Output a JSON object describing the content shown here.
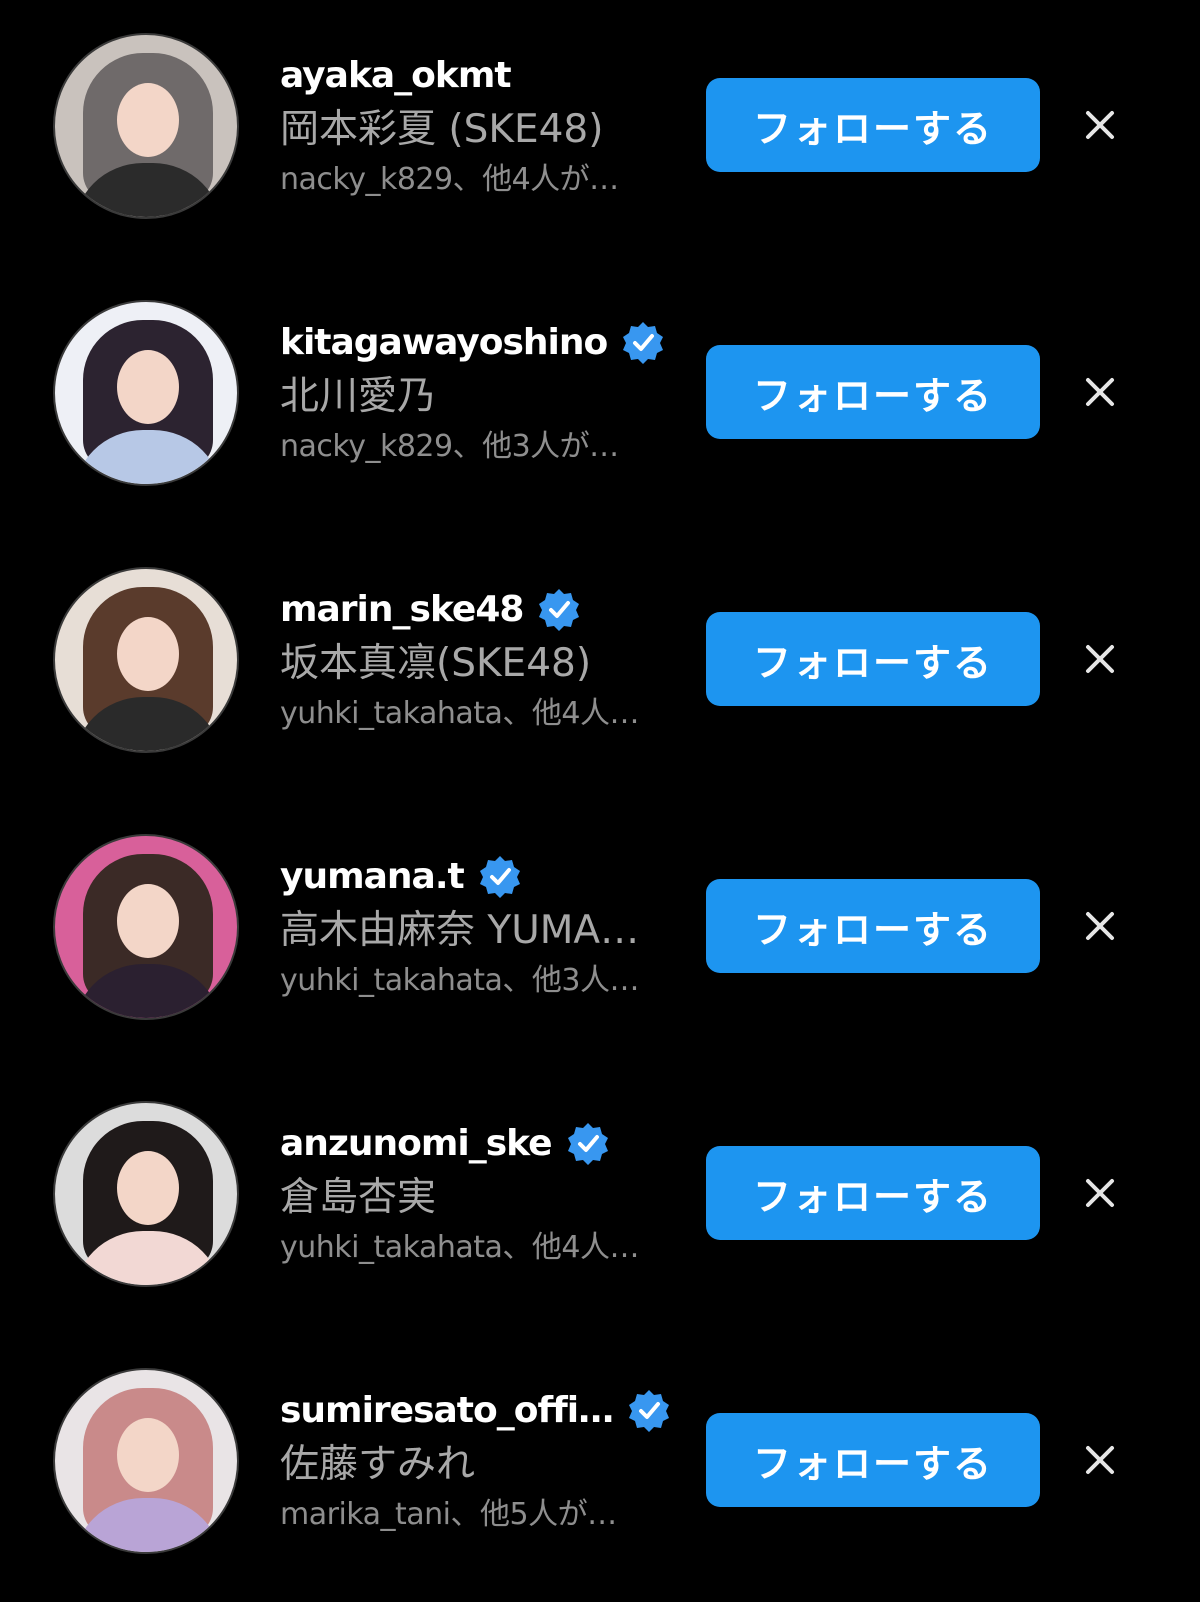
{
  "theme": {
    "background": "#000000",
    "follow_button_color": "#1d95f0",
    "verified_color": "#3897f0"
  },
  "suggestions": [
    {
      "username": "ayaka_okmt",
      "verified": false,
      "display_name": "岡本彩夏 (SKE48)",
      "mutual": "nacky_k829、他4人が…",
      "follow_label": "フォローする",
      "avatar": {
        "hair": "#6f6a6a",
        "body": "#2b2b2b",
        "bg": "#c9c2bd"
      }
    },
    {
      "username": "kitagawayoshino",
      "verified": true,
      "display_name": "北川愛乃",
      "mutual": "nacky_k829、他3人が…",
      "follow_label": "フォローする",
      "avatar": {
        "hair": "#2c2330",
        "body": "#b7c8e6",
        "bg": "#eef0f6"
      }
    },
    {
      "username": "marin_ske48",
      "verified": true,
      "display_name": "坂本真凛(SKE48)",
      "mutual": "yuhki_takahata、他4人…",
      "follow_label": "フォローする",
      "avatar": {
        "hair": "#5a3b2c",
        "body": "#2a2a2a",
        "bg": "#e7ded6"
      }
    },
    {
      "username": "yumana.t",
      "verified": true,
      "display_name": "高木由麻奈 YUMA…",
      "mutual": "yuhki_takahata、他3人…",
      "follow_label": "フォローする",
      "avatar": {
        "hair": "#3b2a26",
        "body": "#2b2030",
        "bg": "#d8609a"
      }
    },
    {
      "username": "anzunomi_ske",
      "verified": true,
      "display_name": "倉島杏実",
      "mutual": "yuhki_takahata、他4人…",
      "follow_label": "フォローする",
      "avatar": {
        "hair": "#1f1a1a",
        "body": "#f2d8d4",
        "bg": "#dcdcdc"
      }
    },
    {
      "username": "sumiresato_offi…",
      "verified": true,
      "display_name": "佐藤すみれ",
      "mutual": "marika_tani、他5人が…",
      "follow_label": "フォローする",
      "avatar": {
        "hair": "#c98a8a",
        "body": "#b9a4d6",
        "bg": "#e9e4e6"
      }
    }
  ]
}
